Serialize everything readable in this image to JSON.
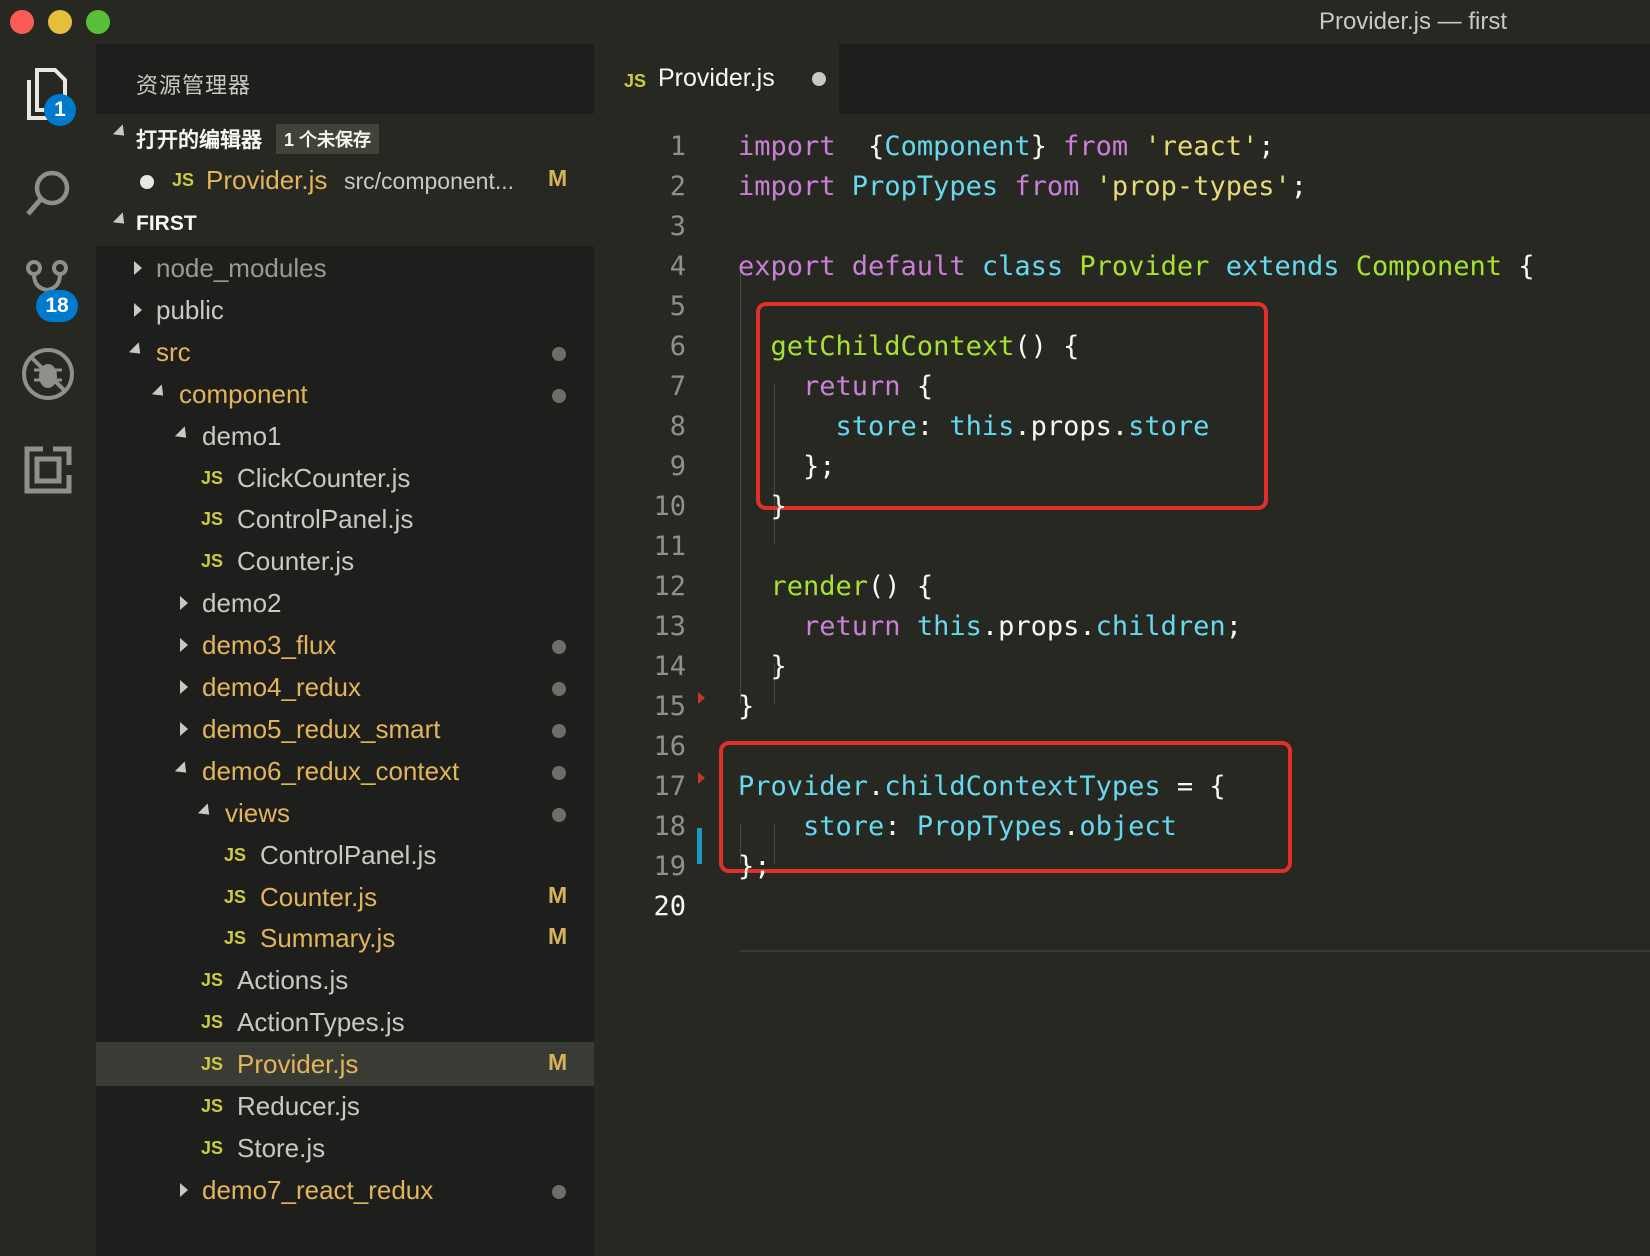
{
  "window": {
    "title": "Provider.js — first"
  },
  "activity_bar": {
    "explorer_badge": "1",
    "scm_badge": "18"
  },
  "sidebar": {
    "title": "资源管理器",
    "open_editors": {
      "label": "打开的编辑器",
      "unsaved": "1 个未保存",
      "file": "Provider.js",
      "path": "src/component...",
      "flag": "M"
    },
    "folder": {
      "label": "FIRST"
    },
    "tree": [
      {
        "name": "node_modules",
        "type": "folder",
        "state": "collapsed",
        "indent": 0,
        "color": "dim"
      },
      {
        "name": "public",
        "type": "folder",
        "state": "collapsed",
        "indent": 0,
        "color": "grey"
      },
      {
        "name": "src",
        "type": "folder",
        "state": "expanded",
        "indent": 0,
        "color": "orange",
        "dot": true
      },
      {
        "name": "component",
        "type": "folder",
        "state": "expanded",
        "indent": 1,
        "color": "orange",
        "dot": true
      },
      {
        "name": "demo1",
        "type": "folder",
        "state": "expanded",
        "indent": 2,
        "color": "grey"
      },
      {
        "name": "ClickCounter.js",
        "type": "file",
        "indent": 3,
        "color": "grey"
      },
      {
        "name": "ControlPanel.js",
        "type": "file",
        "indent": 3,
        "color": "grey"
      },
      {
        "name": "Counter.js",
        "type": "file",
        "indent": 3,
        "color": "grey"
      },
      {
        "name": "demo2",
        "type": "folder",
        "state": "collapsed",
        "indent": 2,
        "color": "grey"
      },
      {
        "name": "demo3_flux",
        "type": "folder",
        "state": "collapsed",
        "indent": 2,
        "color": "orange",
        "dot": true
      },
      {
        "name": "demo4_redux",
        "type": "folder",
        "state": "collapsed",
        "indent": 2,
        "color": "orange",
        "dot": true
      },
      {
        "name": "demo5_redux_smart",
        "type": "folder",
        "state": "collapsed",
        "indent": 2,
        "color": "orange",
        "dot": true
      },
      {
        "name": "demo6_redux_context",
        "type": "folder",
        "state": "expanded",
        "indent": 2,
        "color": "orange",
        "dot": true
      },
      {
        "name": "views",
        "type": "folder",
        "state": "expanded",
        "indent": 3,
        "color": "orange",
        "dot": true
      },
      {
        "name": "ControlPanel.js",
        "type": "file",
        "indent": 4,
        "color": "grey"
      },
      {
        "name": "Counter.js",
        "type": "file",
        "indent": 4,
        "color": "orange",
        "flag": "M"
      },
      {
        "name": "Summary.js",
        "type": "file",
        "indent": 4,
        "color": "orange",
        "flag": "M"
      },
      {
        "name": "Actions.js",
        "type": "file",
        "indent": 3,
        "color": "grey"
      },
      {
        "name": "ActionTypes.js",
        "type": "file",
        "indent": 3,
        "color": "grey"
      },
      {
        "name": "Provider.js",
        "type": "file",
        "indent": 3,
        "color": "orange",
        "flag": "M",
        "selected": true
      },
      {
        "name": "Reducer.js",
        "type": "file",
        "indent": 3,
        "color": "grey"
      },
      {
        "name": "Store.js",
        "type": "file",
        "indent": 3,
        "color": "grey"
      },
      {
        "name": "demo7_react_redux",
        "type": "folder",
        "state": "collapsed",
        "indent": 2,
        "color": "orange",
        "dot": true
      }
    ]
  },
  "editor": {
    "tab": {
      "icon": "JS",
      "name": "Provider.js"
    },
    "lines": [
      [
        [
          "kwp",
          "import"
        ],
        [
          "",
          "  "
        ],
        [
          "",
          "{"
        ],
        [
          "cls",
          "Component"
        ],
        [
          "",
          "}"
        ],
        [
          "",
          ""
        ],
        [
          "kwp",
          " from "
        ],
        [
          "str",
          "'react'"
        ],
        [
          "",
          ";"
        ]
      ],
      [
        [
          "kwp",
          "import"
        ],
        [
          "",
          ""
        ],
        [
          "cls",
          " PropTypes"
        ],
        [
          "kwp",
          " from "
        ],
        [
          "str",
          "'prop-types'"
        ],
        [
          "",
          ";"
        ]
      ],
      [],
      [
        [
          "kwp",
          "export default "
        ],
        [
          "cls",
          "class "
        ],
        [
          "fn",
          "Provider "
        ],
        [
          "cls",
          "extends "
        ],
        [
          "fn",
          "Component"
        ],
        [
          "",
          " {"
        ]
      ],
      [],
      [
        [
          "",
          ""
        ],
        [
          "fn",
          "  getChildContext"
        ],
        [
          "",
          "() {"
        ]
      ],
      [
        [
          "kwp",
          "    return"
        ],
        [
          "",
          " {"
        ]
      ],
      [
        [
          "cls",
          "      store"
        ],
        [
          "",
          ": "
        ],
        [
          "cls",
          "this"
        ],
        [
          "",
          ".props."
        ],
        [
          "cls",
          "store"
        ]
      ],
      [
        [
          "",
          "    };"
        ]
      ],
      [
        [
          "",
          "  }"
        ]
      ],
      [],
      [
        [
          "fn",
          "  render"
        ],
        [
          "",
          "() {"
        ]
      ],
      [
        [
          "kwp",
          "    return "
        ],
        [
          "cls",
          "this"
        ],
        [
          "",
          ".props."
        ],
        [
          "cls",
          "children"
        ],
        [
          "",
          ";"
        ]
      ],
      [
        [
          "",
          "  }"
        ]
      ],
      [
        [
          "",
          "}"
        ]
      ],
      [],
      [
        [
          "cls",
          "Provider"
        ],
        [
          "",
          "."
        ],
        [
          "cls",
          "childContextTypes"
        ],
        [
          "",
          " = {"
        ]
      ],
      [
        [
          "cls",
          "    store"
        ],
        [
          "",
          ": "
        ],
        [
          "cls",
          "PropTypes"
        ],
        [
          "",
          "."
        ],
        [
          "cls",
          "object"
        ]
      ],
      [
        [
          "",
          "};"
        ]
      ],
      []
    ]
  }
}
